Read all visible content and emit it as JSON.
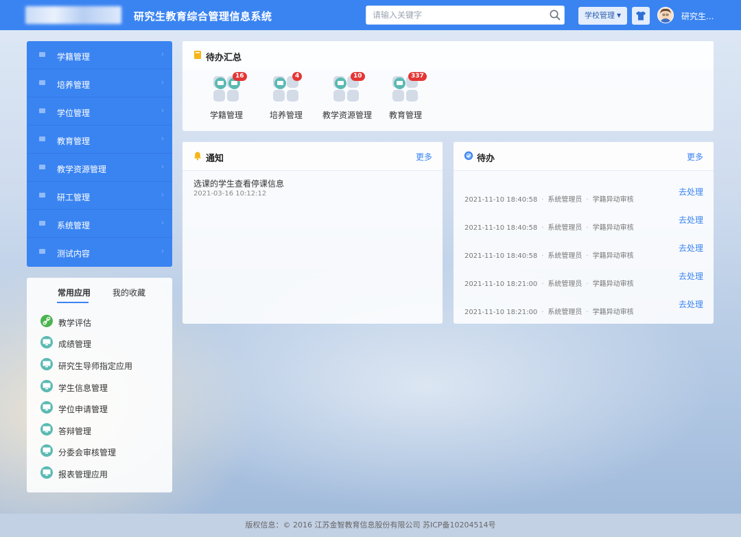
{
  "header": {
    "app_title": "研究生教育综合管理信息系统",
    "search_placeholder": "请输入关键字",
    "role_button": "学校管理",
    "user_name": "研究生..."
  },
  "sidebar": {
    "items": [
      {
        "label": "学籍管理"
      },
      {
        "label": "培养管理"
      },
      {
        "label": "学位管理"
      },
      {
        "label": "教育管理"
      },
      {
        "label": "教学资源管理"
      },
      {
        "label": "研工管理"
      },
      {
        "label": "系统管理"
      },
      {
        "label": "测试内容"
      }
    ]
  },
  "apps": {
    "tabs": [
      "常用应用",
      "我的收藏"
    ],
    "active_tab": 0,
    "items": [
      {
        "label": "教学评估",
        "icon": "link-icon"
      },
      {
        "label": "成绩管理",
        "icon": "monitor-icon"
      },
      {
        "label": "研究生导师指定应用",
        "icon": "monitor-icon"
      },
      {
        "label": "学生信息管理",
        "icon": "monitor-icon"
      },
      {
        "label": "学位申请管理",
        "icon": "monitor-icon"
      },
      {
        "label": "答辩管理",
        "icon": "monitor-icon"
      },
      {
        "label": "分委会审核管理",
        "icon": "monitor-icon"
      },
      {
        "label": "报表管理应用",
        "icon": "monitor-icon"
      }
    ]
  },
  "summary": {
    "title": "待办汇总",
    "items": [
      {
        "label": "学籍管理",
        "count": "16"
      },
      {
        "label": "培养管理",
        "count": "4"
      },
      {
        "label": "教学资源管理",
        "count": "10"
      },
      {
        "label": "教育管理",
        "count": "337"
      }
    ]
  },
  "notice": {
    "title": "通知",
    "more": "更多",
    "items": [
      {
        "title": "选课的学生查看停课信息",
        "time": "2021-03-16 10:12:12"
      }
    ]
  },
  "todo": {
    "title": "待办",
    "more": "更多",
    "items": [
      {
        "time": "2021-11-10 18:40:58",
        "sender": "系统管理员",
        "type": "学籍异动审核",
        "action": "去处理"
      },
      {
        "time": "2021-11-10 18:40:58",
        "sender": "系统管理员",
        "type": "学籍异动审核",
        "action": "去处理"
      },
      {
        "time": "2021-11-10 18:40:58",
        "sender": "系统管理员",
        "type": "学籍异动审核",
        "action": "去处理"
      },
      {
        "time": "2021-11-10 18:21:00",
        "sender": "系统管理员",
        "type": "学籍异动审核",
        "action": "去处理"
      },
      {
        "time": "2021-11-10 18:21:00",
        "sender": "系统管理员",
        "type": "学籍异动审核",
        "action": "去处理"
      }
    ]
  },
  "footer": {
    "text": "版权信息：© 2016 江苏金智教育信息股份有限公司 苏ICP备10204514号"
  },
  "colors": {
    "primary": "#3a84f2",
    "badge": "#e53535",
    "app_icon": "#5bbab3"
  }
}
